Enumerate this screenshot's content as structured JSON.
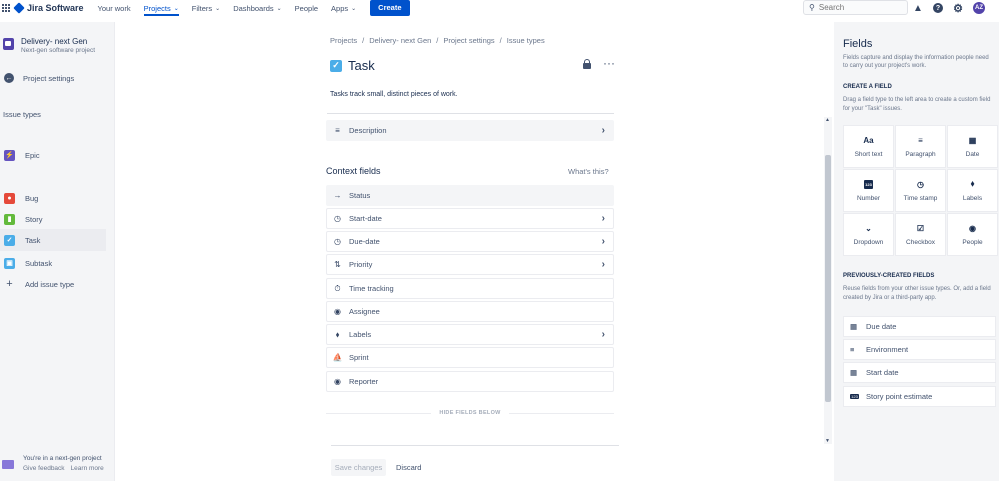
{
  "topnav": {
    "product": "Jira Software",
    "items": [
      {
        "label": "Your work",
        "chevron": false,
        "active": false
      },
      {
        "label": "Projects",
        "chevron": true,
        "active": true
      },
      {
        "label": "Filters",
        "chevron": true,
        "active": false
      },
      {
        "label": "Dashboards",
        "chevron": true,
        "active": false
      },
      {
        "label": "People",
        "chevron": false,
        "active": false
      },
      {
        "label": "Apps",
        "chevron": true,
        "active": false
      }
    ],
    "create_label": "Create",
    "search_placeholder": "Search",
    "avatar_initials": "AZ",
    "icons": [
      "grid-icon",
      "notifications-icon",
      "help-icon",
      "settings-icon"
    ]
  },
  "sidebar": {
    "project_name": "Delivery- next Gen",
    "project_type": "Next-gen software project",
    "back_label": "Project settings",
    "section_title": "Issue types",
    "issue_types": [
      {
        "label": "Epic",
        "color": "#6554c0",
        "glyph": "⚡"
      },
      {
        "label": "Bug",
        "color": "#e5493a",
        "glyph": "●"
      },
      {
        "label": "Story",
        "color": "#63ba3c",
        "glyph": "▮"
      },
      {
        "label": "Task",
        "color": "#4bade8",
        "glyph": "✓",
        "selected": true
      }
    ],
    "subtask": {
      "label": "Subtask",
      "color": "#4bade8",
      "glyph": "▣"
    },
    "add_label": "Add issue type",
    "footer": {
      "line1": "You're in a next-gen project",
      "feedback": "Give feedback",
      "learn": "Learn more"
    }
  },
  "main": {
    "breadcrumb": [
      "Projects",
      "Delivery- next Gen",
      "Project settings",
      "Issue types"
    ],
    "title": "Task",
    "description": "Tasks track small, distinct pieces of work.",
    "description_field": {
      "label": "Description",
      "icon": "≡"
    },
    "context_title": "Context fields",
    "whats_this": "What's this?",
    "fields": [
      {
        "label": "Status",
        "icon": "→",
        "chevron": false,
        "grey": true
      },
      {
        "label": "Start-date",
        "icon": "◷",
        "chevron": true,
        "grey": false
      },
      {
        "label": "Due-date",
        "icon": "◷",
        "chevron": true,
        "grey": false
      },
      {
        "label": "Priority",
        "icon": "⇅",
        "chevron": true,
        "grey": false
      },
      {
        "label": "Time tracking",
        "icon": "⏱",
        "chevron": false,
        "grey": false
      },
      {
        "label": "Assignee",
        "icon": "◉",
        "chevron": false,
        "grey": false
      },
      {
        "label": "Labels",
        "icon": "⬧",
        "chevron": true,
        "grey": false
      },
      {
        "label": "Sprint",
        "icon": "⛵",
        "chevron": false,
        "grey": false
      },
      {
        "label": "Reporter",
        "icon": "◉",
        "chevron": false,
        "grey": false
      }
    ],
    "hide_label": "HIDE FIELDS BELOW",
    "save_label": "Save changes",
    "discard_label": "Discard"
  },
  "fields_panel": {
    "title": "Fields",
    "description": "Fields capture and display the information people need to carry out your project's work.",
    "create_title": "CREATE A FIELD",
    "create_desc": "Drag a field type to the left area to create a custom field for your \"Task\" issues.",
    "tiles": [
      {
        "label": "Short text",
        "icon": "Aa"
      },
      {
        "label": "Paragraph",
        "icon": "≡"
      },
      {
        "label": "Date",
        "icon": "▦"
      },
      {
        "label": "Number",
        "icon": "123"
      },
      {
        "label": "Time stamp",
        "icon": "◷"
      },
      {
        "label": "Labels",
        "icon": "⬧"
      },
      {
        "label": "Dropdown",
        "icon": "⌄"
      },
      {
        "label": "Checkbox",
        "icon": "☑"
      },
      {
        "label": "People",
        "icon": "◉"
      }
    ],
    "prev_title": "PREVIOUSLY-CREATED FIELDS",
    "prev_desc": "Reuse fields from your other issue types. Or, add a field created by Jira or a third-party app.",
    "prev_fields": [
      {
        "label": "Due date",
        "icon": "▦"
      },
      {
        "label": "Environment",
        "icon": "≡"
      },
      {
        "label": "Start date",
        "icon": "▦"
      },
      {
        "label": "Story point estimate",
        "icon": "123"
      }
    ]
  }
}
